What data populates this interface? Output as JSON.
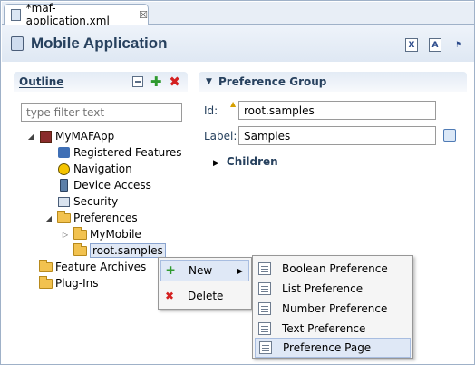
{
  "editor_tab": {
    "label": "*maf-application.xml",
    "close_glyph": "☒"
  },
  "header": {
    "title": "Mobile Application",
    "icons": [
      "xml-view-icon",
      "app-preview-icon",
      "tool-icon"
    ],
    "icon_labels": [
      "X",
      "A",
      "⚑"
    ]
  },
  "outline": {
    "title": "Outline",
    "filter_placeholder": "type filter text",
    "tree": [
      {
        "label": "MyMAFApp",
        "icon": "app-icon",
        "expanded": true
      },
      {
        "label": "Registered Features",
        "icon": "features-icon"
      },
      {
        "label": "Navigation",
        "icon": "navigation-icon"
      },
      {
        "label": "Device Access",
        "icon": "device-access-icon"
      },
      {
        "label": "Security",
        "icon": "security-icon"
      },
      {
        "label": "Preferences",
        "icon": "folder-icon",
        "expanded": true
      },
      {
        "label": "MyMobile",
        "icon": "folder-icon"
      },
      {
        "label": "root.samples",
        "icon": "folder-icon",
        "selected": true
      },
      {
        "label": "Feature Archives",
        "icon": "folder-icon"
      },
      {
        "label": "Plug-Ins",
        "icon": "folder-icon"
      }
    ]
  },
  "preference_group": {
    "title": "Preference Group",
    "id_label": "Id:",
    "id_value": "root.samples",
    "label_label": "Label:",
    "label_value": "Samples",
    "children_label": "Children"
  },
  "context_menu": {
    "items": [
      {
        "label": "New",
        "icon": "add-icon",
        "highlighted": true
      },
      {
        "label": "Delete",
        "icon": "delete-icon"
      }
    ]
  },
  "submenu": {
    "items": [
      {
        "label": "Boolean Preference"
      },
      {
        "label": "List Preference"
      },
      {
        "label": "Number Preference"
      },
      {
        "label": "Text Preference"
      },
      {
        "label": "Preference Page",
        "highlighted": true
      }
    ]
  },
  "colors": {
    "accent": "#27415e",
    "selection": "#dfe8f6",
    "folder": "#f2c24f"
  }
}
